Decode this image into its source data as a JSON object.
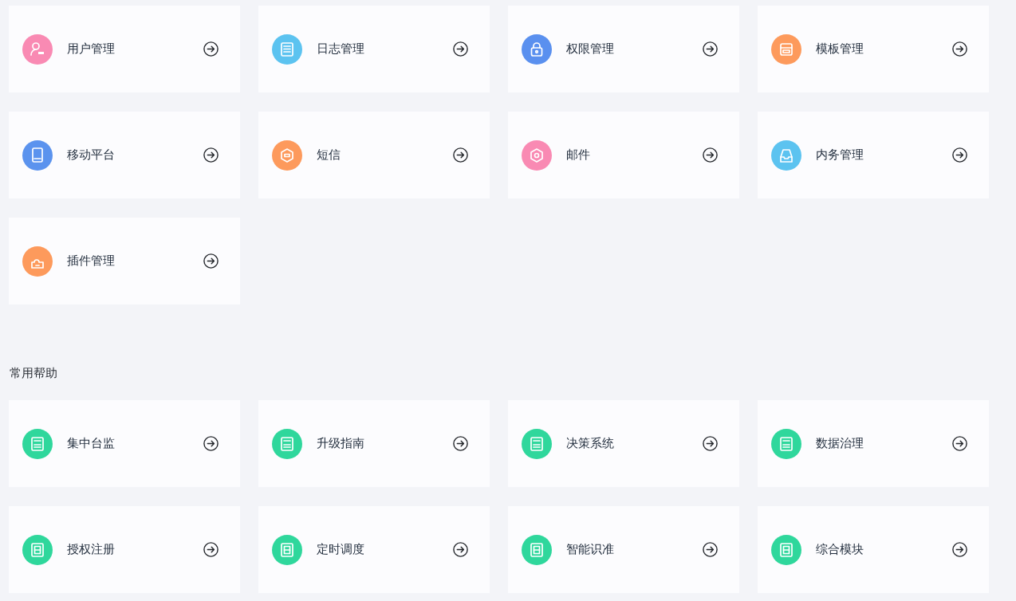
{
  "modules": [
    {
      "label": "用户管理",
      "color": "#f98ab3"
    },
    {
      "label": "日志管理",
      "color": "#5cc3f0"
    },
    {
      "label": "权限管理",
      "color": "#5a90ef"
    },
    {
      "label": "模板管理",
      "color": "#fd9a5c"
    },
    {
      "label": "移动平台",
      "color": "#5b93ee"
    },
    {
      "label": "短信",
      "color": "#fd9a5c"
    },
    {
      "label": "邮件",
      "color": "#f98ab3"
    },
    {
      "label": "内务管理",
      "color": "#5cc3f0"
    },
    {
      "label": "插件管理",
      "color": "#fd9a5c"
    }
  ],
  "help_section": {
    "title": "常用帮助",
    "items": [
      {
        "label": "集中台监"
      },
      {
        "label": "升级指南"
      },
      {
        "label": "决策系统"
      },
      {
        "label": "数据治理"
      },
      {
        "label": "授权注册"
      },
      {
        "label": "定时调度"
      },
      {
        "label": "智能识准"
      },
      {
        "label": "综合模块"
      }
    ]
  }
}
